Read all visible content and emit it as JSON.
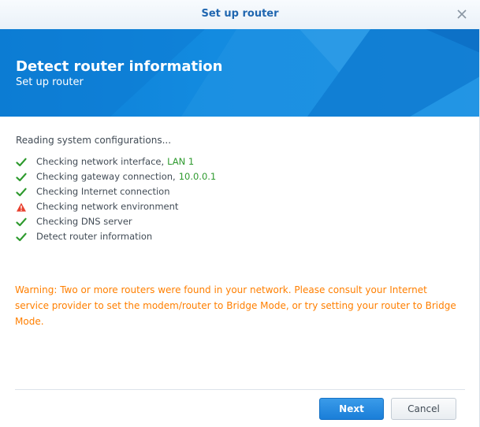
{
  "window": {
    "title": "Set up router",
    "close_icon": "close-icon"
  },
  "banner": {
    "heading": "Detect router information",
    "subheading": "Set up router",
    "color": "#138be0"
  },
  "main": {
    "status_text": "Reading system configurations...",
    "checks": [
      {
        "label": "Checking network interface,",
        "value": "LAN 1",
        "status": "ok",
        "icon": "check-icon"
      },
      {
        "label": "Checking gateway connection,",
        "value": "10.0.0.1",
        "status": "ok",
        "icon": "check-icon"
      },
      {
        "label": "Checking Internet connection",
        "value": "",
        "status": "ok",
        "icon": "check-icon"
      },
      {
        "label": "Checking network environment",
        "value": "",
        "status": "warning",
        "icon": "warning-icon"
      },
      {
        "label": "Checking DNS server",
        "value": "",
        "status": "ok",
        "icon": "check-icon"
      },
      {
        "label": "Detect router information",
        "value": "",
        "status": "ok",
        "icon": "check-icon"
      }
    ],
    "warning_text": "Warning: Two or more routers were found in your network. Please consult your Internet service provider to set the modem/router to Bridge Mode, or try setting your router to Bridge Mode.",
    "warning_color": "#ff7f00",
    "ok_color": "#2e9a2e"
  },
  "footer": {
    "next_label": "Next",
    "cancel_label": "Cancel"
  }
}
